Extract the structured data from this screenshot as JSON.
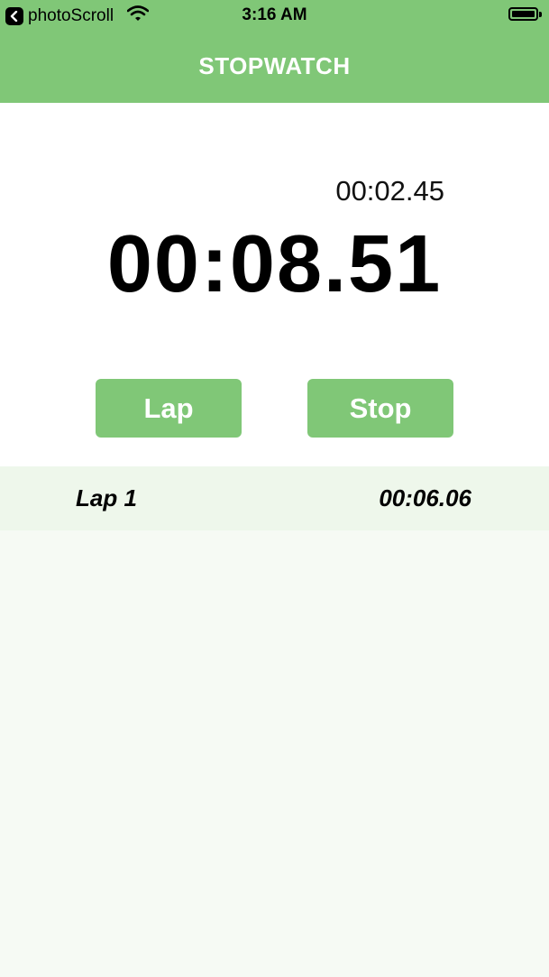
{
  "status_bar": {
    "back_app": "photoScroll",
    "time": "3:16 AM"
  },
  "header": {
    "title": "STOPWATCH"
  },
  "timer": {
    "lap_time": "00:02.45",
    "total_time": "00:08.51"
  },
  "buttons": {
    "lap_label": "Lap",
    "stop_label": "Stop"
  },
  "laps": [
    {
      "name": "Lap 1",
      "time": "00:06.06"
    }
  ],
  "colors": {
    "accent": "#80c777",
    "background": "#f6faf4",
    "row": "#eef7eb"
  },
  "icons": {
    "back": "chevron-left-icon",
    "wifi": "wifi-icon",
    "battery": "battery-icon"
  }
}
